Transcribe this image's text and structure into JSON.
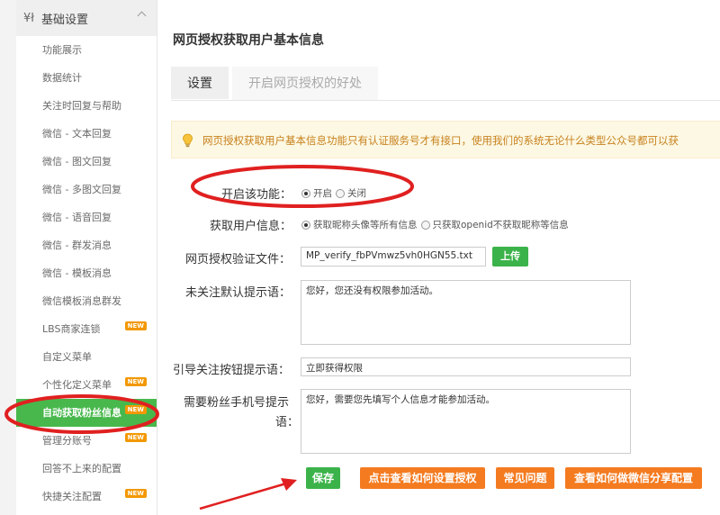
{
  "sidebar": {
    "section_title": "基础设置",
    "items": [
      {
        "label": "功能展示",
        "new": false
      },
      {
        "label": "数据统计",
        "new": false
      },
      {
        "label": "关注时回复与帮助",
        "new": false
      },
      {
        "label": "微信 - 文本回复",
        "new": false
      },
      {
        "label": "微信 - 图文回复",
        "new": false
      },
      {
        "label": "微信 - 多图文回复",
        "new": false
      },
      {
        "label": "微信 - 语音回复",
        "new": false
      },
      {
        "label": "微信 - 群发消息",
        "new": false
      },
      {
        "label": "微信 - 模板消息",
        "new": false
      },
      {
        "label": "微信模板消息群发",
        "new": false
      },
      {
        "label": "LBS商家连锁",
        "new": true
      },
      {
        "label": "自定义菜单",
        "new": false
      },
      {
        "label": "个性化定义菜单",
        "new": true
      },
      {
        "label": "自动获取粉丝信息",
        "new": true,
        "active": true
      },
      {
        "label": "管理分账号",
        "new": true
      },
      {
        "label": "回答不上来的配置",
        "new": false
      },
      {
        "label": "快捷关注配置",
        "new": true
      }
    ],
    "new_badge": "NEW"
  },
  "main": {
    "page_title": "网页授权获取用户基本信息",
    "tabs": [
      {
        "label": "设置",
        "active": true
      },
      {
        "label": "开启网页授权的好处",
        "active": false
      }
    ],
    "notice": "网页授权获取用户基本信息功能只有认证服务号才有接口，使用我们的系统无论什么类型公众号都可以获",
    "form": {
      "enable_label": "开启该功能：",
      "enable_on": "开启",
      "enable_off": "关闭",
      "fetch_label": "获取用户信息：",
      "fetch_opt1": "获取昵称头像等所有信息",
      "fetch_opt2": "只获取openid不获取昵称等信息",
      "verify_label": "网页授权验证文件：",
      "verify_value": "MP_verify_fbPVmwz5vh0HGN55.txt",
      "upload_button": "上传",
      "unfollow_label": "未关注默认提示语：",
      "unfollow_value": "您好，您还没有权限参加活动。",
      "guide_label": "引导关注按钮提示语：",
      "guide_value": "立即获得权限",
      "phone_label_line1": "需要粉丝手机号提示",
      "phone_label_line2": "语：",
      "phone_value": "您好，需要您先填写个人信息才能参加活动。"
    },
    "buttons": {
      "save": "保存",
      "howto_auth": "点击查看如何设置授权",
      "faq": "常见问题",
      "howto_share": "查看如何做微信分享配置"
    }
  },
  "colors": {
    "accent_green": "#3cb34a",
    "accent_orange": "#f47b20",
    "annotation_red": "#e02020",
    "notice_text": "#c8811e",
    "new_badge": "#f39800"
  }
}
